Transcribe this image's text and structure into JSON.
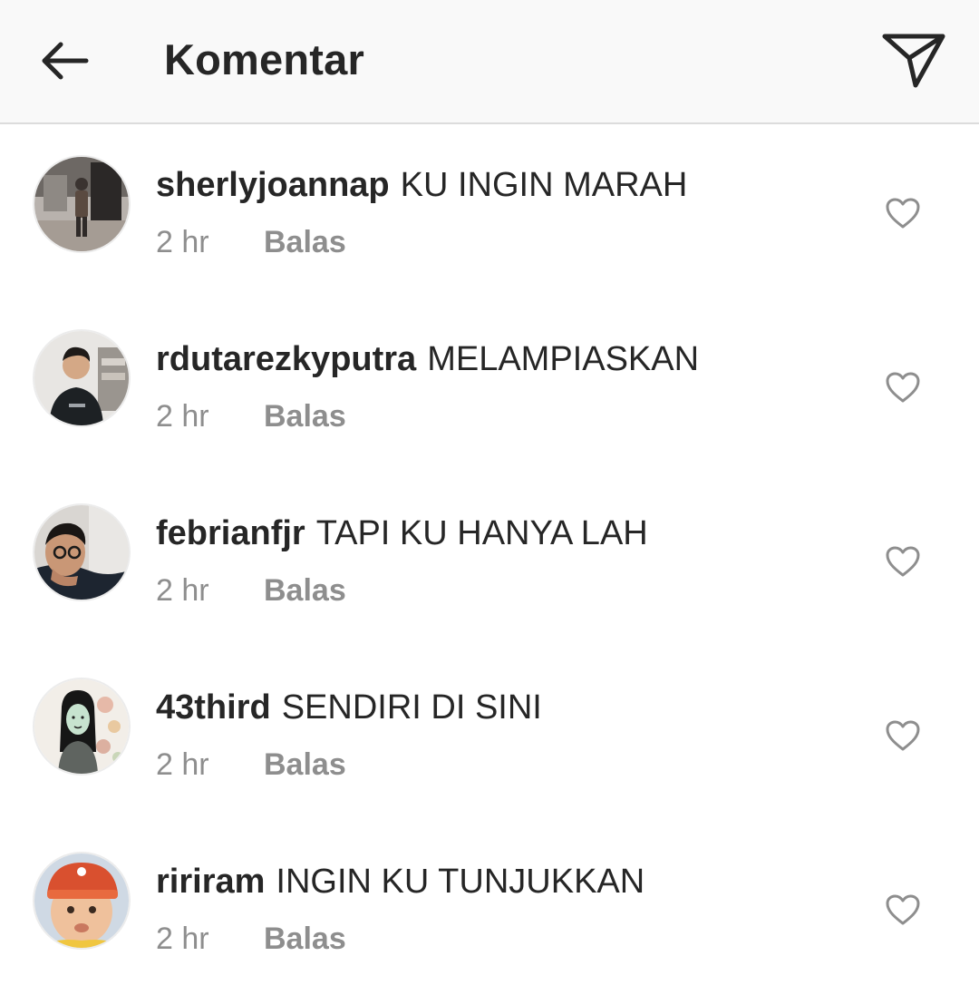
{
  "header": {
    "back_icon": "arrow-left-icon",
    "title": "Komentar",
    "share_icon": "paper-plane-icon"
  },
  "comments": [
    {
      "username": "sherlyjoannap",
      "text": "KU INGIN MARAH",
      "time": "2 hr",
      "reply_label": "Balas",
      "like_icon": "heart-outline-icon"
    },
    {
      "username": "rdutarezkyputra",
      "text": "MELAMPIASKAN",
      "time": "2 hr",
      "reply_label": "Balas",
      "like_icon": "heart-outline-icon"
    },
    {
      "username": "febrianfjr",
      "text": "TAPI KU HANYA LAH",
      "time": "2 hr",
      "reply_label": "Balas",
      "like_icon": "heart-outline-icon"
    },
    {
      "username": "43third",
      "text": "SENDIRI DI SINI",
      "time": "2 hr",
      "reply_label": "Balas",
      "like_icon": "heart-outline-icon"
    },
    {
      "username": "ririram",
      "text": "INGIN KU TUNJUKKAN",
      "time": "2 hr",
      "reply_label": "Balas",
      "like_icon": "heart-outline-icon"
    }
  ],
  "colors": {
    "text_primary": "#262626",
    "text_secondary": "#8e8e8e",
    "header_bg": "#f9f9f9",
    "divider": "#dcdcdc"
  }
}
